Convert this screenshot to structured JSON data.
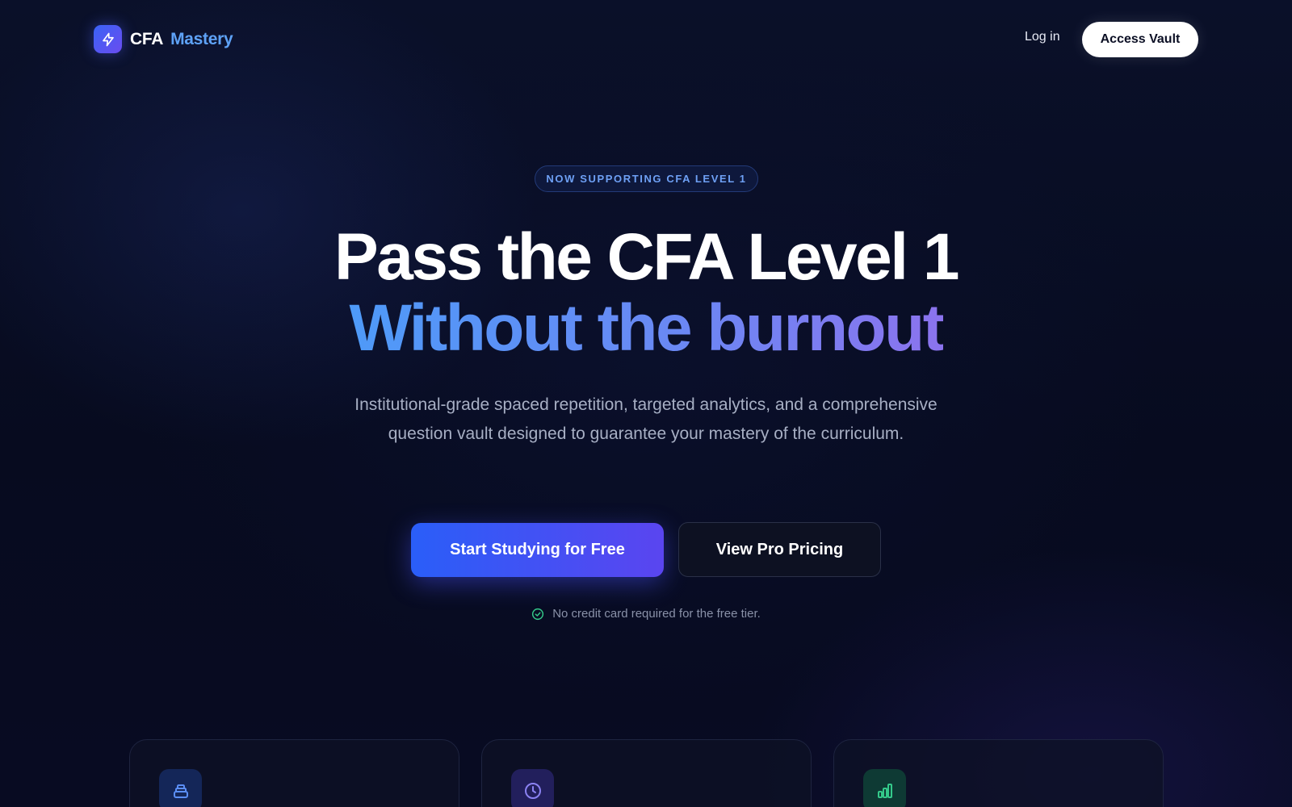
{
  "nav": {
    "brand_part1": "CFA",
    "brand_part2": "Mastery",
    "brand_icon": "lightning-bolt-icon",
    "login_label": "Log in",
    "access_label": "Access Vault"
  },
  "hero": {
    "badge": "NOW SUPPORTING CFA LEVEL 1",
    "title_line1": "Pass the CFA Level 1",
    "title_line2": "Without the burnout",
    "subtitle": "Institutional-grade spaced repetition, targeted analytics, and a comprehensive question vault designed to guarantee your mastery of the curriculum.",
    "primary_cta": "Start Studying for Free",
    "secondary_cta": "View Pro Pricing",
    "note": "No credit card required for the free tier."
  },
  "features": [
    {
      "icon": "stack-icon",
      "accent": "#5b8ef5",
      "bg": "#142658"
    },
    {
      "icon": "clock-icon",
      "accent": "#8b82f2",
      "bg": "#221f5c"
    },
    {
      "icon": "bar-chart-icon",
      "accent": "#34c98a",
      "bg": "#0e3a34"
    }
  ],
  "colors": {
    "background": "#070b1f",
    "accent_blue": "#4e9af8",
    "accent_violet": "#8b73ee",
    "success": "#34c98a"
  }
}
